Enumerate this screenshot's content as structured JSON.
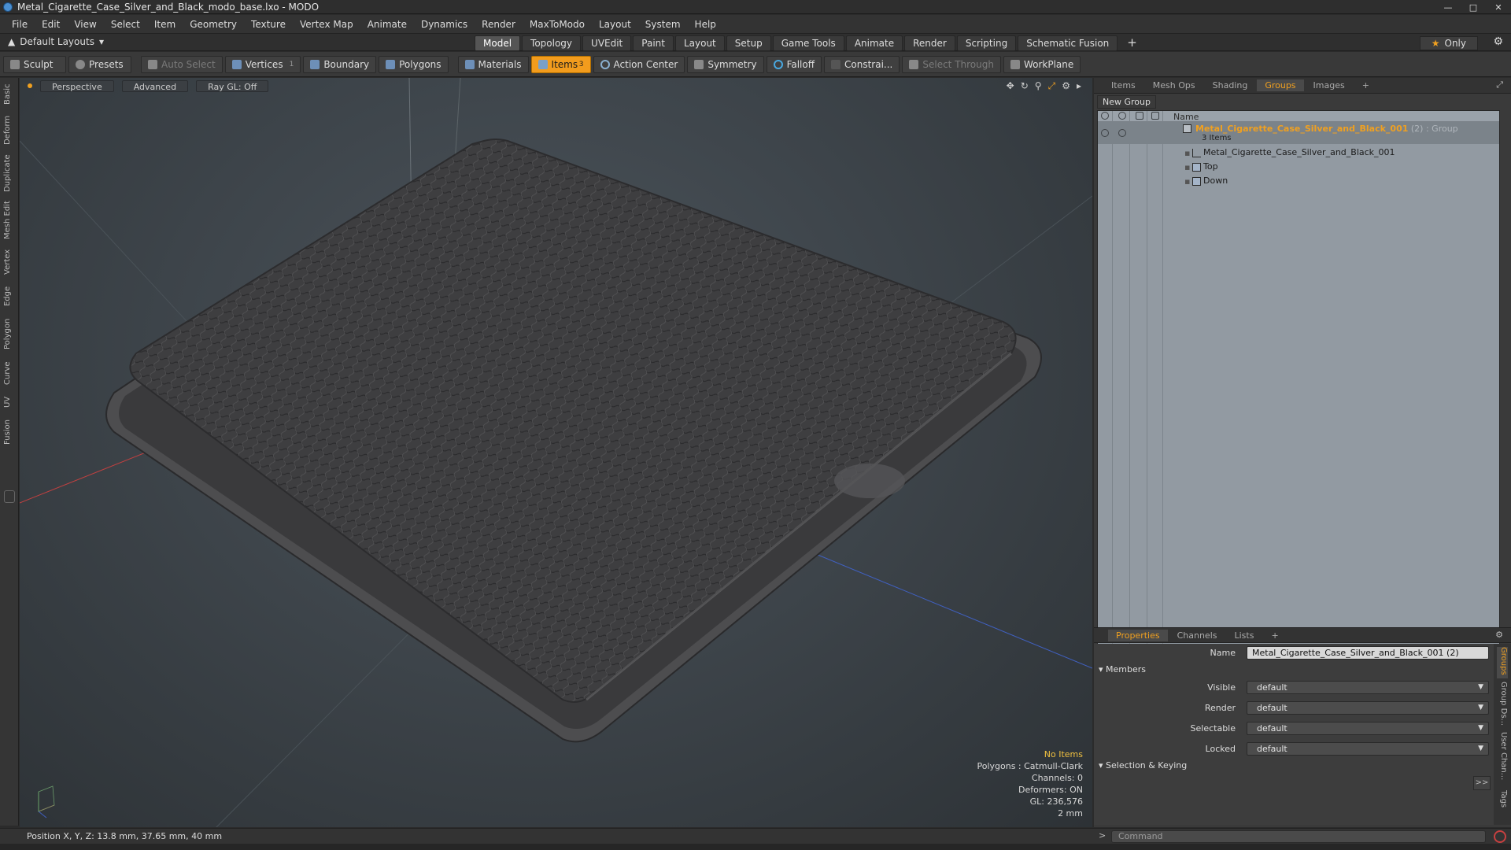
{
  "window": {
    "title": "Metal_Cigarette_Case_Silver_and_Black_modo_base.lxo - MODO"
  },
  "menu": [
    "File",
    "Edit",
    "View",
    "Select",
    "Item",
    "Geometry",
    "Texture",
    "Vertex Map",
    "Animate",
    "Dynamics",
    "Render",
    "MaxToModo",
    "Layout",
    "System",
    "Help"
  ],
  "layout": {
    "selector": "Default Layouts",
    "tabs": [
      "Model",
      "Topology",
      "UVEdit",
      "Paint",
      "Layout",
      "Setup",
      "Game Tools",
      "Animate",
      "Render",
      "Scripting",
      "Schematic Fusion"
    ],
    "active_tab": "Model",
    "only_label": "Only"
  },
  "toolbar": {
    "sculpt": "Sculpt",
    "presets": "Presets",
    "auto_select": "Auto Select",
    "vertices": "Vertices",
    "vertices_count": "1",
    "boundary": "Boundary",
    "polygons": "Polygons",
    "materials": "Materials",
    "items": "Items",
    "items_count": "3",
    "action_center": "Action Center",
    "symmetry": "Symmetry",
    "falloff": "Falloff",
    "constraints": "Constrai...",
    "select_through": "Select Through",
    "workplane": "WorkPlane"
  },
  "left_tabs": [
    "Basic",
    "Deform",
    "Duplicate",
    "Mesh Edit",
    "Vertex",
    "Edge",
    "Polygon",
    "Curve",
    "UV",
    "Fusion"
  ],
  "viewport": {
    "view": "Perspective",
    "advanced": "Advanced",
    "raygl": "Ray GL: Off",
    "stats": {
      "no_items": "No Items",
      "polygons": "Polygons : Catmull-Clark",
      "channels": "Channels: 0",
      "deformers": "Deformers: ON",
      "gl": "GL: 236,576",
      "scale": "2 mm"
    }
  },
  "right_panel": {
    "tabs": [
      "Items",
      "Mesh Ops",
      "Shading",
      "Groups",
      "Images"
    ],
    "active_tab": "Groups",
    "new_group": "New Group",
    "column_name": "Name",
    "group": {
      "name": "Metal_Cigarette_Case_Silver_and_Black_001",
      "suffix": "(2) : Group",
      "count": "3 Items",
      "children": [
        "Metal_Cigarette_Case_Silver_and_Black_001",
        "Top",
        "Down"
      ]
    }
  },
  "properties": {
    "tabs": [
      "Properties",
      "Channels",
      "Lists"
    ],
    "active_tab": "Properties",
    "name_label": "Name",
    "name_value": "Metal_Cigarette_Case_Silver_and_Black_001 (2)",
    "members_section": "Members",
    "rows": [
      {
        "label": "Visible",
        "value": "default"
      },
      {
        "label": "Render",
        "value": "default"
      },
      {
        "label": "Selectable",
        "value": "default"
      },
      {
        "label": "Locked",
        "value": "default"
      }
    ],
    "selection_section": "Selection & Keying",
    "side_tabs": [
      "Groups",
      "Group Ds...",
      "User Chan...",
      "Tags"
    ]
  },
  "status": {
    "position": "Position X, Y, Z:   13.8 mm, 37.65 mm, 40 mm"
  },
  "command": {
    "placeholder": "Command"
  },
  "colors": {
    "accent": "#f29c1d",
    "tree_bg": "#929aa2",
    "viewport_bg": "#3e454b"
  }
}
